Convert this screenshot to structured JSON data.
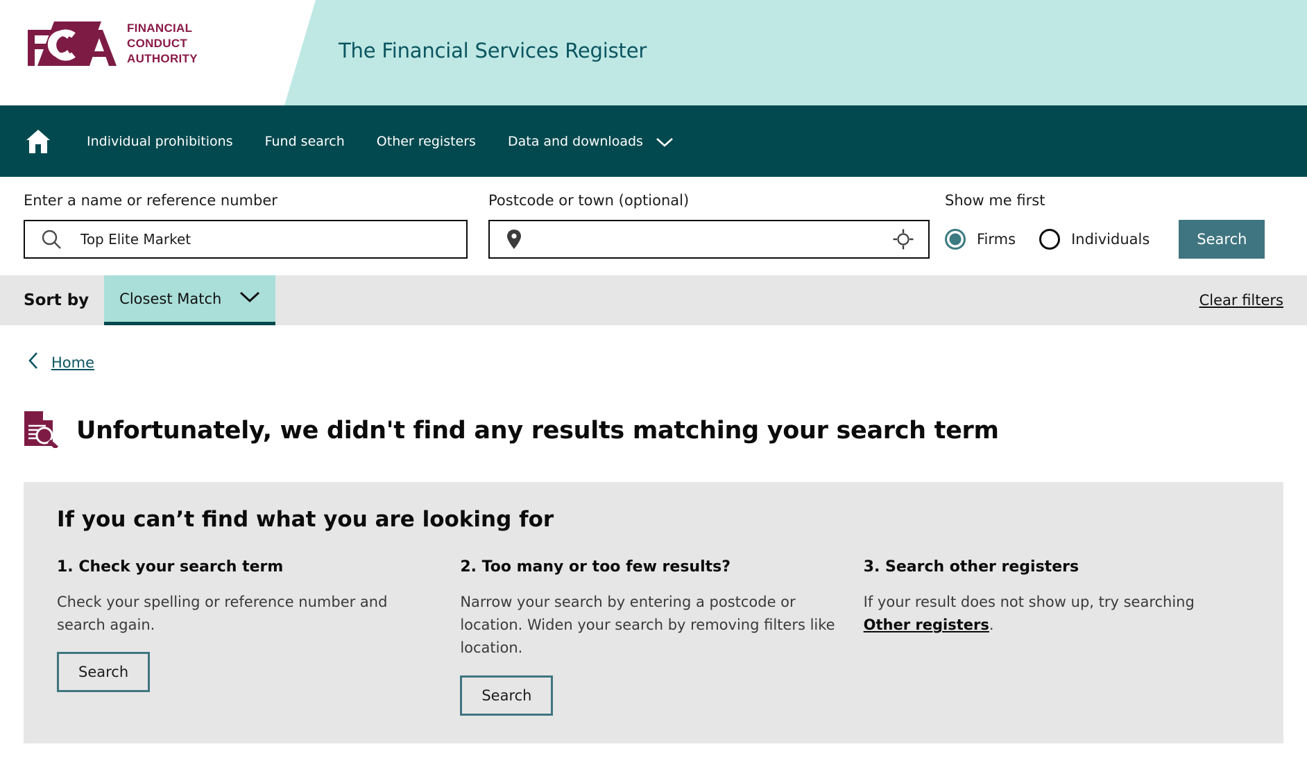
{
  "header": {
    "logo_letters": "FCA",
    "logo_line1": "FINANCIAL",
    "logo_line2": "CONDUCT",
    "logo_line3": "AUTHORITY",
    "title": "The Financial Services Register",
    "brand_maroon": "#8a1a47",
    "banner_teal": "#bfe8e4",
    "title_color": "#0b5560"
  },
  "nav": {
    "bg_color": "#02494f",
    "home_icon": "home-icon",
    "items": [
      {
        "label": "Individual prohibitions",
        "has_chevron": false
      },
      {
        "label": "Fund search",
        "has_chevron": false
      },
      {
        "label": "Other registers",
        "has_chevron": false
      },
      {
        "label": "Data and downloads",
        "has_chevron": true
      }
    ]
  },
  "search": {
    "name_label": "Enter a name or reference number",
    "name_value": "Top Elite Market",
    "name_placeholder": "",
    "name_icon": "search-icon",
    "postcode_label": "Postcode or town (optional)",
    "postcode_value": "",
    "postcode_placeholder": "",
    "postcode_lead_icon": "map-pin-icon",
    "postcode_trail_icon": "crosshair-locate-icon",
    "show_me_first_label": "Show me first",
    "radio_firms": "Firms",
    "radio_individuals": "Individuals",
    "selected_radio": "Firms",
    "search_button": "Search",
    "search_button_color": "#3f7580"
  },
  "sortbar": {
    "sort_by_label": "Sort by",
    "sort_value": "Closest Match",
    "sort_chevron_icon": "chevron-down-icon",
    "sort_bg": "#aadfd9",
    "sort_underline": "#02494f",
    "clear_filters": "Clear filters",
    "bar_bg": "#e6e6e6"
  },
  "breadcrumb": {
    "back_icon": "chevron-left-icon",
    "home_label": "Home"
  },
  "result": {
    "icon": "document-search-icon",
    "heading": "Unfortunately, we didn't find any results matching your search term"
  },
  "help": {
    "panel_title": "If you can’t find what you are looking for",
    "panel_bg": "#e6e6e6",
    "columns": [
      {
        "heading": "1. Check your search term",
        "body": "Check your spelling or reference number and search again.",
        "button": "Search",
        "has_button": true,
        "link_text": "",
        "body_tail": ""
      },
      {
        "heading": "2. Too many or too few results?",
        "body": "Narrow your search by entering a postcode or location. Widen your search by removing filters like location.",
        "button": "Search",
        "has_button": true,
        "link_text": "",
        "body_tail": ""
      },
      {
        "heading": "3. Search other registers",
        "body": "If your result does not show up, try searching ",
        "button": "",
        "has_button": false,
        "link_text": "Other registers",
        "body_tail": "."
      }
    ]
  }
}
